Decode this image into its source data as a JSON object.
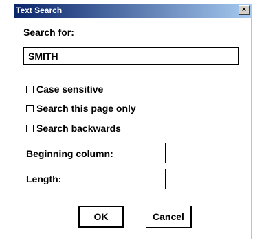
{
  "window": {
    "title": "Text Search",
    "close_glyph": "×"
  },
  "search": {
    "label": "Search for:",
    "value": "SMITH"
  },
  "options": [
    {
      "label": "Case sensitive",
      "checked": false
    },
    {
      "label": "Search this page only",
      "checked": false
    },
    {
      "label": "Search backwards",
      "checked": false
    }
  ],
  "fields": {
    "beginning_column_label": "Beginning column:",
    "beginning_column_value": "",
    "length_label": "Length:",
    "length_value": ""
  },
  "buttons": {
    "ok_label": "OK",
    "cancel_label": "Cancel"
  },
  "colors": {
    "titlebar_start": "#0a246a",
    "titlebar_end": "#a6caf0",
    "title_text": "#ffffff"
  }
}
